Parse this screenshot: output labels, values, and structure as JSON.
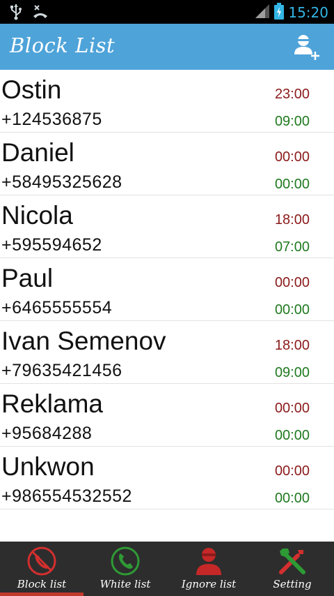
{
  "status_bar": {
    "time": "15:20"
  },
  "app_bar": {
    "title": "Block List",
    "add_icon": "add-user-icon"
  },
  "contacts": [
    {
      "name": "Ostin",
      "phone": "+124536875",
      "time_start": "23:00",
      "time_end": "09:00"
    },
    {
      "name": "Daniel",
      "phone": "+58495325628",
      "time_start": "00:00",
      "time_end": "00:00"
    },
    {
      "name": "Nicola",
      "phone": "+595594652",
      "time_start": "18:00",
      "time_end": "07:00"
    },
    {
      "name": "Paul",
      "phone": "+6465555554",
      "time_start": "00:00",
      "time_end": "00:00"
    },
    {
      "name": "Ivan Semenov",
      "phone": "+79635421456",
      "time_start": "18:00",
      "time_end": "09:00"
    },
    {
      "name": "Reklama",
      "phone": "+95684288",
      "time_start": "00:00",
      "time_end": "00:00"
    },
    {
      "name": "Unkwon",
      "phone": "+986554532552",
      "time_start": "00:00",
      "time_end": "00:00"
    }
  ],
  "bottom_nav": {
    "tabs": [
      {
        "label": "Block list",
        "icon": "block-call-icon",
        "active": true
      },
      {
        "label": "White list",
        "icon": "phone-icon",
        "active": false
      },
      {
        "label": "Ignore list",
        "icon": "person-icon",
        "active": false
      },
      {
        "label": "Setting",
        "icon": "tools-icon",
        "active": false
      }
    ]
  },
  "colors": {
    "status_bar_bg": "#000000",
    "accent": "#33b5e5",
    "app_bar_bg": "#4ea3d9",
    "time_start": "#8b1a1a",
    "time_end": "#1f7a1f",
    "nav_bg": "#2d2d2d",
    "active_tab_indicator": "#c0392b"
  }
}
